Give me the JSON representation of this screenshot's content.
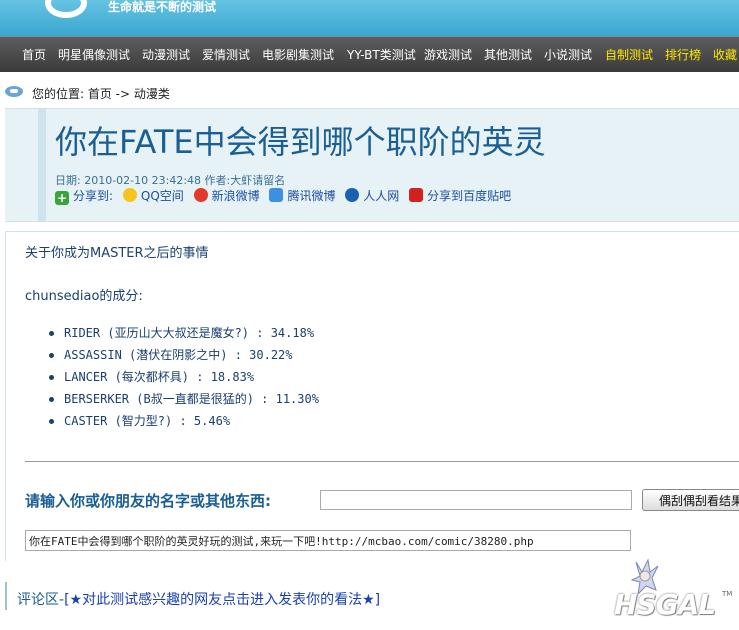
{
  "header": {
    "slogan": "生命就是不断的测试"
  },
  "nav": [
    {
      "label": "首页",
      "highlight": false
    },
    {
      "label": "明星偶像测试",
      "highlight": false
    },
    {
      "label": "动漫测试",
      "highlight": false
    },
    {
      "label": "爱情测试",
      "highlight": false
    },
    {
      "label": "电影剧集测试",
      "highlight": false
    },
    {
      "label": "YY-BT类测试",
      "highlight": false
    },
    {
      "label": "游戏测试",
      "highlight": false
    },
    {
      "label": "其他测试",
      "highlight": false
    },
    {
      "label": "小说测试",
      "highlight": false
    },
    {
      "label": "自制测试",
      "highlight": true
    },
    {
      "label": "排行榜",
      "highlight": true
    },
    {
      "label": "收藏",
      "highlight": true
    }
  ],
  "breadcrumb": {
    "text": "您的位置: 首页 -> 动漫类"
  },
  "article": {
    "title": "你在FATE中会得到哪个职阶的英灵",
    "date_label": "日期:",
    "date": "2010-02-10 23:42:48",
    "author_label": "作者:",
    "author": "大虾请留名",
    "share": {
      "label": "分享到:",
      "targets": [
        "QQ空间",
        "新浪微博",
        "腾讯微博",
        "人人网",
        "分享到百度贴吧"
      ]
    }
  },
  "result": {
    "intro": "关于你成为MASTER之后的事情",
    "subject_line": "chunsediao的成分:",
    "items": [
      "RIDER (亚历山大大叔还是魔女?) : 34.18%",
      "ASSASSIN (潜伏在阴影之中) : 30.22%",
      "LANCER (每次都杯具) : 18.83%",
      "BERSERKER (B叔一直都是很猛的) : 11.30%",
      "CASTER (智力型?) : 5.46%"
    ]
  },
  "form": {
    "prompt": "请输入你或你朋友的名字或其他东西:",
    "name_value": "",
    "button_label": "偶刮偶刮看结果",
    "share_text": "你在FATE中会得到哪个职阶的英灵好玩的测试,来玩一下吧!http://mcbao.com/comic/38280.php"
  },
  "comments": {
    "label": "评论区-",
    "link_text": "[★对此测试感兴趣的网友点击进入发表你的看法★]"
  },
  "watermark": {
    "text": "HSGAL",
    "tm": "TM"
  }
}
